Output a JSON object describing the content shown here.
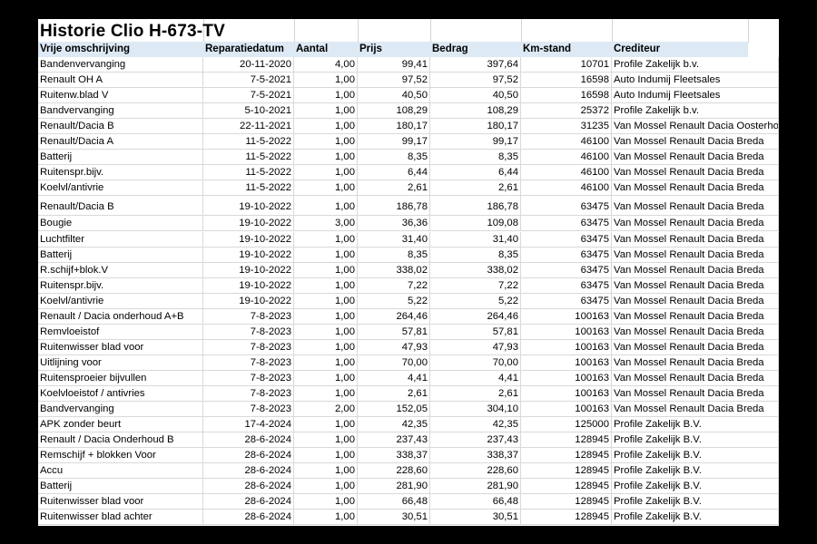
{
  "title": "Historie Clio H-673-TV",
  "columns": [
    "Vrije omschrijving",
    "Reparatiedatum",
    "Aantal",
    "Prijs",
    "Bedrag",
    "Km-stand",
    "Crediteur"
  ],
  "rows": [
    {
      "desc": "Bandenvervanging",
      "date": "20-11-2020",
      "qty": "4,00",
      "price": "99,41",
      "amount": "397,64",
      "km": "10701",
      "creditor": "Profile Zakelijk b.v."
    },
    {
      "desc": "Renault OH A",
      "date": "7-5-2021",
      "qty": "1,00",
      "price": "97,52",
      "amount": "97,52",
      "km": "16598",
      "creditor": "Auto Indumij Fleetsales"
    },
    {
      "desc": "Ruitenw.blad V",
      "date": "7-5-2021",
      "qty": "1,00",
      "price": "40,50",
      "amount": "40,50",
      "km": "16598",
      "creditor": "Auto Indumij Fleetsales"
    },
    {
      "desc": "Bandvervanging",
      "date": "5-10-2021",
      "qty": "1,00",
      "price": "108,29",
      "amount": "108,29",
      "km": "25372",
      "creditor": "Profile Zakelijk b.v."
    },
    {
      "desc": "Renault/Dacia B",
      "date": "22-11-2021",
      "qty": "1,00",
      "price": "180,17",
      "amount": "180,17",
      "km": "31235",
      "creditor": "Van Mossel Renault Dacia Oosterhout"
    },
    {
      "desc": "Renault/Dacia A",
      "date": "11-5-2022",
      "qty": "1,00",
      "price": "99,17",
      "amount": "99,17",
      "km": "46100",
      "creditor": "Van Mossel Renault Dacia Breda"
    },
    {
      "desc": "Batterij",
      "date": "11-5-2022",
      "qty": "1,00",
      "price": "8,35",
      "amount": "8,35",
      "km": "46100",
      "creditor": "Van Mossel Renault Dacia Breda"
    },
    {
      "desc": "Ruitenspr.bijv.",
      "date": "11-5-2022",
      "qty": "1,00",
      "price": "6,44",
      "amount": "6,44",
      "km": "46100",
      "creditor": "Van Mossel Renault Dacia Breda"
    },
    {
      "desc": "Koelvl/antivrie",
      "date": "11-5-2022",
      "qty": "1,00",
      "price": "2,61",
      "amount": "2,61",
      "km": "46100",
      "creditor": "Van Mossel Renault Dacia Breda"
    },
    {
      "desc": "Renault/Dacia B",
      "date": "19-10-2022",
      "qty": "1,00",
      "price": "186,78",
      "amount": "186,78",
      "km": "63475",
      "creditor": "Van Mossel Renault Dacia Breda"
    },
    {
      "desc": "Bougie",
      "date": "19-10-2022",
      "qty": "3,00",
      "price": "36,36",
      "amount": "109,08",
      "km": "63475",
      "creditor": "Van Mossel Renault Dacia Breda"
    },
    {
      "desc": "Luchtfilter",
      "date": "19-10-2022",
      "qty": "1,00",
      "price": "31,40",
      "amount": "31,40",
      "km": "63475",
      "creditor": "Van Mossel Renault Dacia Breda"
    },
    {
      "desc": "Batterij",
      "date": "19-10-2022",
      "qty": "1,00",
      "price": "8,35",
      "amount": "8,35",
      "km": "63475",
      "creditor": "Van Mossel Renault Dacia Breda"
    },
    {
      "desc": "R.schijf+blok.V",
      "date": "19-10-2022",
      "qty": "1,00",
      "price": "338,02",
      "amount": "338,02",
      "km": "63475",
      "creditor": "Van Mossel Renault Dacia Breda"
    },
    {
      "desc": "Ruitenspr.bijv.",
      "date": "19-10-2022",
      "qty": "1,00",
      "price": "7,22",
      "amount": "7,22",
      "km": "63475",
      "creditor": "Van Mossel Renault Dacia Breda"
    },
    {
      "desc": "Koelvl/antivrie",
      "date": "19-10-2022",
      "qty": "1,00",
      "price": "5,22",
      "amount": "5,22",
      "km": "63475",
      "creditor": "Van Mossel Renault Dacia Breda"
    },
    {
      "desc": "Renault / Dacia onderhoud A+B",
      "date": "7-8-2023",
      "qty": "1,00",
      "price": "264,46",
      "amount": "264,46",
      "km": "100163",
      "creditor": "Van Mossel Renault Dacia Breda"
    },
    {
      "desc": "Remvloeistof",
      "date": "7-8-2023",
      "qty": "1,00",
      "price": "57,81",
      "amount": "57,81",
      "km": "100163",
      "creditor": "Van Mossel Renault Dacia Breda"
    },
    {
      "desc": "Ruitenwisser blad voor",
      "date": "7-8-2023",
      "qty": "1,00",
      "price": "47,93",
      "amount": "47,93",
      "km": "100163",
      "creditor": "Van Mossel Renault Dacia Breda"
    },
    {
      "desc": "Uitlijning voor",
      "date": "7-8-2023",
      "qty": "1,00",
      "price": "70,00",
      "amount": "70,00",
      "km": "100163",
      "creditor": "Van Mossel Renault Dacia Breda"
    },
    {
      "desc": "Ruitensproeier bijvullen",
      "date": "7-8-2023",
      "qty": "1,00",
      "price": "4,41",
      "amount": "4,41",
      "km": "100163",
      "creditor": "Van Mossel Renault Dacia Breda"
    },
    {
      "desc": "Koelvloeistof / antivries",
      "date": "7-8-2023",
      "qty": "1,00",
      "price": "2,61",
      "amount": "2,61",
      "km": "100163",
      "creditor": "Van Mossel Renault Dacia Breda"
    },
    {
      "desc": "Bandvervanging",
      "date": "7-8-2023",
      "qty": "2,00",
      "price": "152,05",
      "amount": "304,10",
      "km": "100163",
      "creditor": "Van Mossel Renault Dacia Breda"
    },
    {
      "desc": "APK zonder beurt",
      "date": "17-4-2024",
      "qty": "1,00",
      "price": "42,35",
      "amount": "42,35",
      "km": "125000",
      "creditor": "Profile Zakelijk B.V."
    },
    {
      "desc": "Renault / Dacia Onderhoud B",
      "date": "28-6-2024",
      "qty": "1,00",
      "price": "237,43",
      "amount": "237,43",
      "km": "128945",
      "creditor": "Profile Zakelijk B.V."
    },
    {
      "desc": "Remschijf + blokken Voor",
      "date": "28-6-2024",
      "qty": "1,00",
      "price": "338,37",
      "amount": "338,37",
      "km": "128945",
      "creditor": "Profile Zakelijk B.V."
    },
    {
      "desc": "Accu",
      "date": "28-6-2024",
      "qty": "1,00",
      "price": "228,60",
      "amount": "228,60",
      "km": "128945",
      "creditor": "Profile Zakelijk B.V."
    },
    {
      "desc": "Batterij",
      "date": "28-6-2024",
      "qty": "1,00",
      "price": "281,90",
      "amount": "281,90",
      "km": "128945",
      "creditor": "Profile Zakelijk B.V."
    },
    {
      "desc": "Ruitenwisser blad voor",
      "date": "28-6-2024",
      "qty": "1,00",
      "price": "66,48",
      "amount": "66,48",
      "km": "128945",
      "creditor": "Profile Zakelijk B.V."
    },
    {
      "desc": "Ruitenwisser blad achter",
      "date": "28-6-2024",
      "qty": "1,00",
      "price": "30,51",
      "amount": "30,51",
      "km": "128945",
      "creditor": "Profile Zakelijk B.V."
    }
  ]
}
